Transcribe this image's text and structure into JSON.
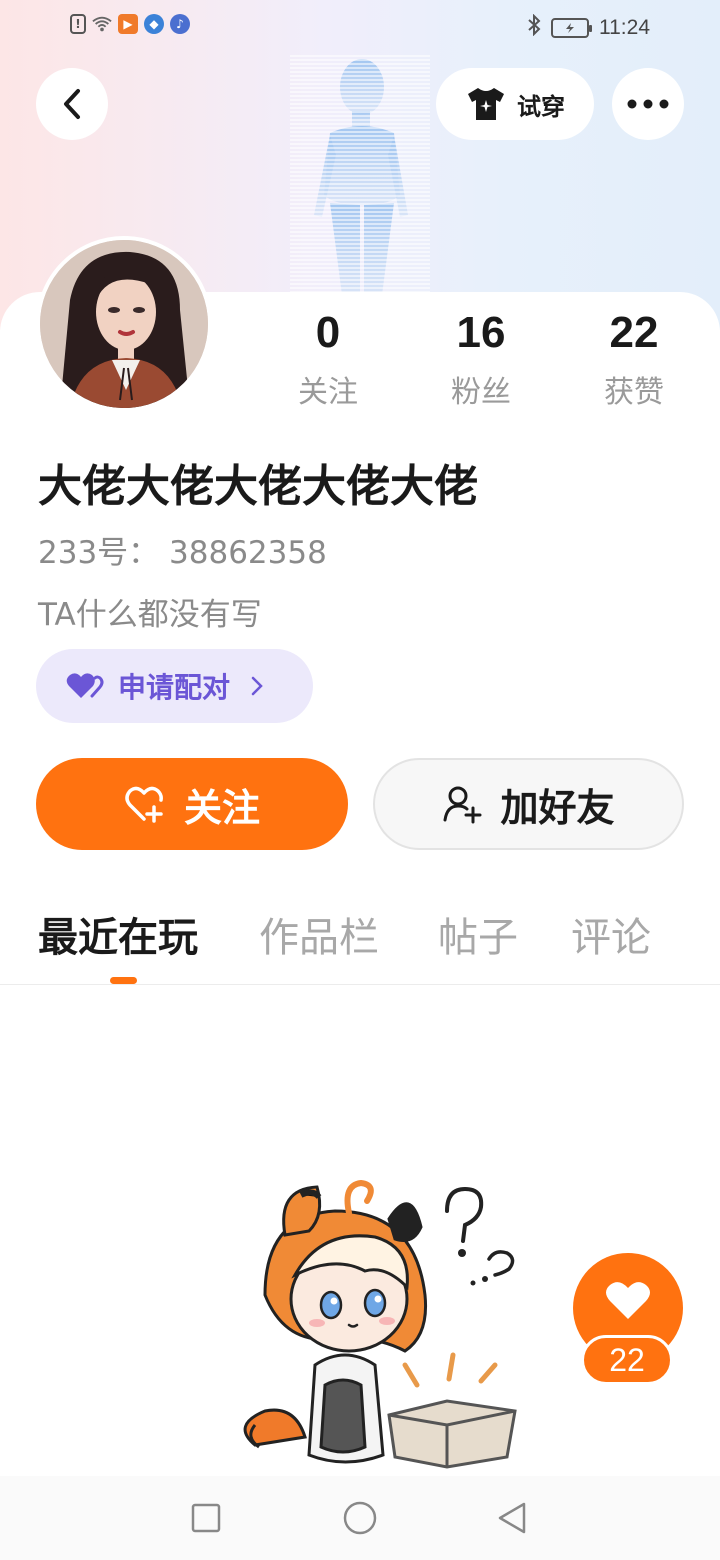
{
  "status_bar": {
    "time": "11:24",
    "left_icons": [
      "sim-alert-icon",
      "wifi-icon",
      "video-app-icon",
      "browser-app-icon",
      "music-app-icon"
    ],
    "right_icons": [
      "bluetooth-icon",
      "battery-charging-icon"
    ]
  },
  "header": {
    "try_on_label": "试穿",
    "back_icon": "chevron-left-icon",
    "more_icon": "more-dots-icon"
  },
  "profile": {
    "stats": [
      {
        "num": "0",
        "label": "关注"
      },
      {
        "num": "16",
        "label": "粉丝"
      },
      {
        "num": "22",
        "label": "获赞"
      }
    ],
    "username": "大佬大佬大佬大佬大佬",
    "user_id": "233号： 38862358",
    "bio": "TA什么都没有写",
    "pair_label": "申请配对"
  },
  "actions": {
    "follow_label": "关注",
    "add_friend_label": "加好友"
  },
  "tabs": [
    {
      "label": "最近在玩",
      "active": true
    },
    {
      "label": "作品栏",
      "active": false
    },
    {
      "label": "帖子",
      "active": false
    },
    {
      "label": "评论",
      "active": false
    }
  ],
  "like": {
    "count": "22"
  },
  "colors": {
    "accent": "#ff7210",
    "pair_text": "#6b56d6",
    "pair_bg": "#ece9fb"
  }
}
